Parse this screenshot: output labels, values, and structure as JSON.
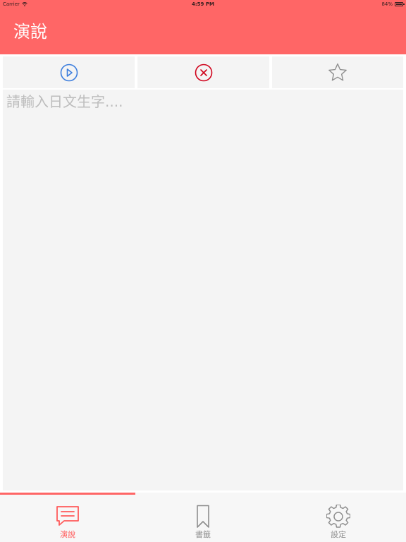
{
  "status_bar": {
    "carrier": "Carrier",
    "time": "4:59 PM",
    "battery": "84%"
  },
  "header": {
    "title": "演說"
  },
  "toolbar": {
    "buttons": [
      {
        "icon": "play-circle-icon",
        "color": "#3b7ddd"
      },
      {
        "icon": "close-circle-icon",
        "color": "#d0021b"
      },
      {
        "icon": "star-icon",
        "color": "#8e8e8e"
      }
    ]
  },
  "editor": {
    "placeholder": "請輸入日文生字....",
    "value": ""
  },
  "tabbar": {
    "active_index": 0,
    "tabs": [
      {
        "label": "演說",
        "icon": "speech-bubble-icon"
      },
      {
        "label": "書籤",
        "icon": "bookmark-icon"
      },
      {
        "label": "設定",
        "icon": "gear-icon"
      }
    ]
  },
  "colors": {
    "accent": "#ff6666",
    "panel": "#f4f4f4"
  }
}
